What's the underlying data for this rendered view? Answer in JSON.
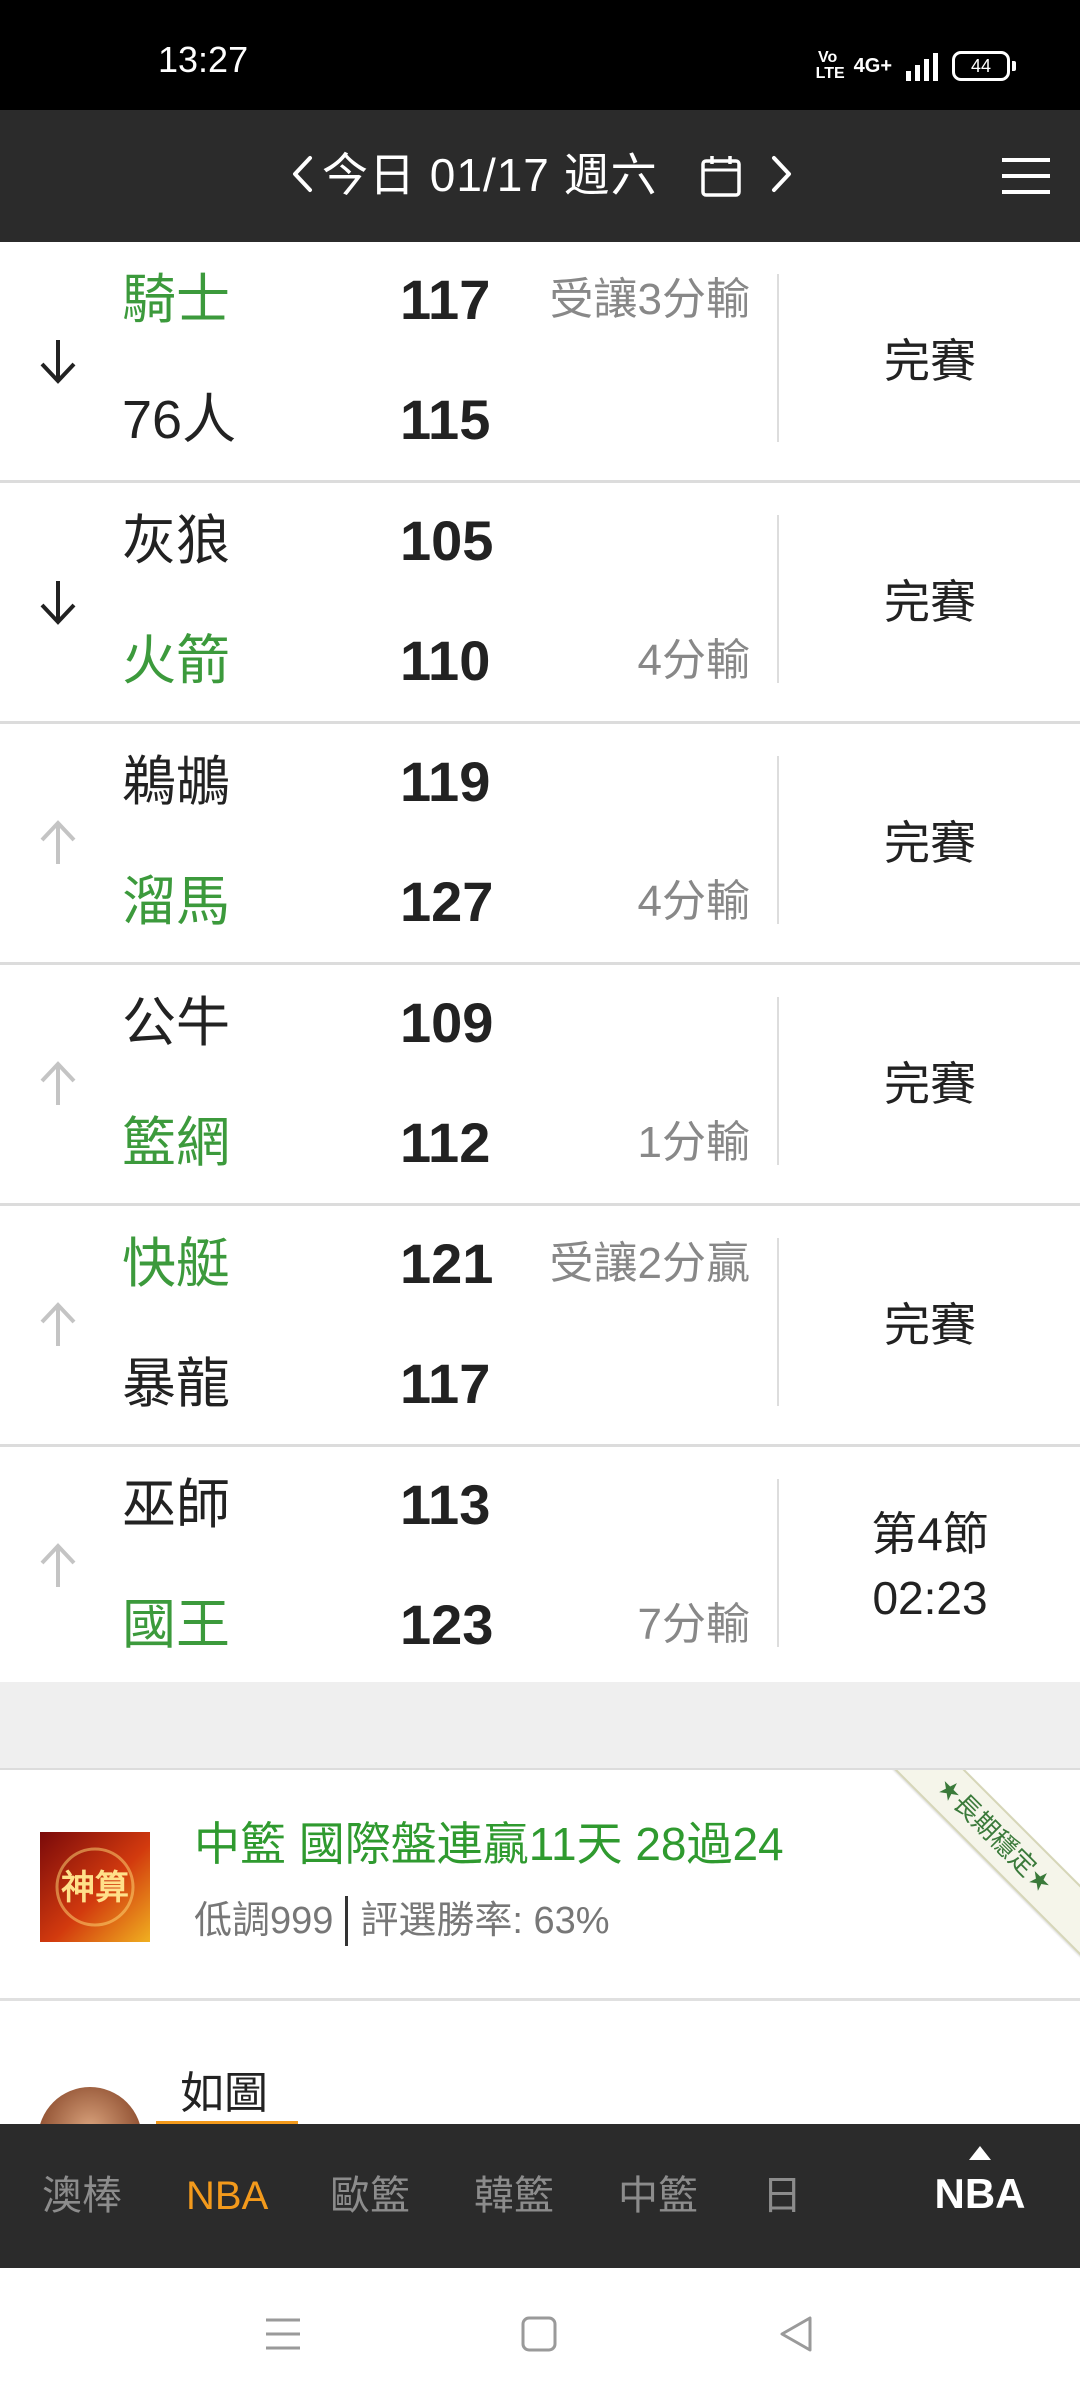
{
  "status_bar": {
    "time": "13:27",
    "volte": "Vo LTE",
    "network": "4G+",
    "battery": "44"
  },
  "date_header": {
    "label": "今日 01/17 週六",
    "icons": [
      "chevron-left-icon",
      "calendar-icon",
      "chevron-right-icon",
      "hamburger-menu-icon"
    ]
  },
  "games": [
    {
      "trend": "down",
      "top": {
        "team": "騎士",
        "score": "117",
        "winner": true,
        "note": "受讓3分輸"
      },
      "bottom": {
        "team": "76人",
        "score": "115",
        "winner": false,
        "note": ""
      },
      "status": [
        "完賽"
      ]
    },
    {
      "trend": "down",
      "top": {
        "team": "灰狼",
        "score": "105",
        "winner": false,
        "note": ""
      },
      "bottom": {
        "team": "火箭",
        "score": "110",
        "winner": true,
        "note": "4分輸"
      },
      "status": [
        "完賽"
      ]
    },
    {
      "trend": "up",
      "top": {
        "team": "鵜鶘",
        "score": "119",
        "winner": false,
        "note": ""
      },
      "bottom": {
        "team": "溜馬",
        "score": "127",
        "winner": true,
        "note": "4分輸"
      },
      "status": [
        "完賽"
      ]
    },
    {
      "trend": "up",
      "top": {
        "team": "公牛",
        "score": "109",
        "winner": false,
        "note": ""
      },
      "bottom": {
        "team": "籃網",
        "score": "112",
        "winner": true,
        "note": "1分輸"
      },
      "status": [
        "完賽"
      ]
    },
    {
      "trend": "up",
      "top": {
        "team": "快艇",
        "score": "121",
        "winner": true,
        "note": "受讓2分贏"
      },
      "bottom": {
        "team": "暴龍",
        "score": "117",
        "winner": false,
        "note": ""
      },
      "status": [
        "完賽"
      ]
    },
    {
      "trend": "up",
      "top": {
        "team": "巫師",
        "score": "113",
        "winner": false,
        "note": ""
      },
      "bottom": {
        "team": "國王",
        "score": "123",
        "winner": true,
        "note": "7分輸"
      },
      "status": [
        "第4節",
        "02:23"
      ]
    }
  ],
  "promo": {
    "title": "中籃 國際盤連贏11天 28過24",
    "author": "低調999",
    "win_rate": "評選勝率: 63%",
    "ribbon": "★長期穩定★",
    "logo_text": "神算"
  },
  "post": {
    "title": "如圖"
  },
  "tabs": {
    "items": [
      {
        "label": "澳棒",
        "active": false
      },
      {
        "label": "NBA",
        "active": true
      },
      {
        "label": "歐籃",
        "active": false
      },
      {
        "label": "韓籃",
        "active": false
      },
      {
        "label": "中籃",
        "active": false
      },
      {
        "label": "日",
        "active": false
      }
    ],
    "right_label": "NBA"
  },
  "colors": {
    "winner_green": "#3c9a3c",
    "accent_orange": "#f39a1c",
    "header_bg": "#2b2b2b"
  }
}
